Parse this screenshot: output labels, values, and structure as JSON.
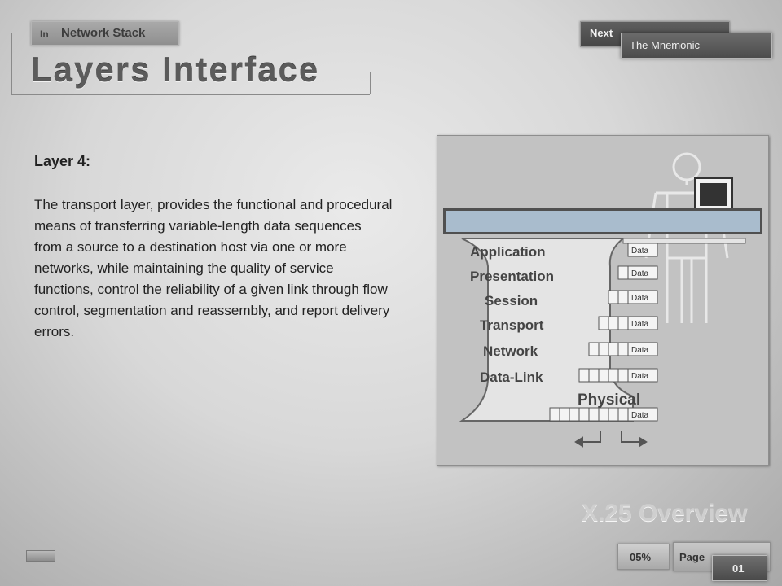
{
  "header": {
    "in_label": "In",
    "topic": "Network Stack",
    "title": "Layers Interface",
    "next_label": "Next",
    "next_topic": "The Mnemonic"
  },
  "content": {
    "layer_heading": "Layer 4:",
    "layer_body": "The transport layer, provides the functional and procedural means of transferring variable-length data sequences from a source to a destination host via one or more networks, while maintaining the quality of service functions, control the reliability of a given link through flow control, segmentation and reassembly, and report delivery errors."
  },
  "diagram": {
    "layers": [
      "Application",
      "Presentation",
      "Session",
      "Transport",
      "Network",
      "Data-Link",
      "Physical"
    ],
    "data_label": "Data",
    "highlighted_layer": "Data"
  },
  "watermark": "X.25 Overview",
  "footer": {
    "progress": "05%",
    "page_label": "Page",
    "page_number": "01"
  }
}
